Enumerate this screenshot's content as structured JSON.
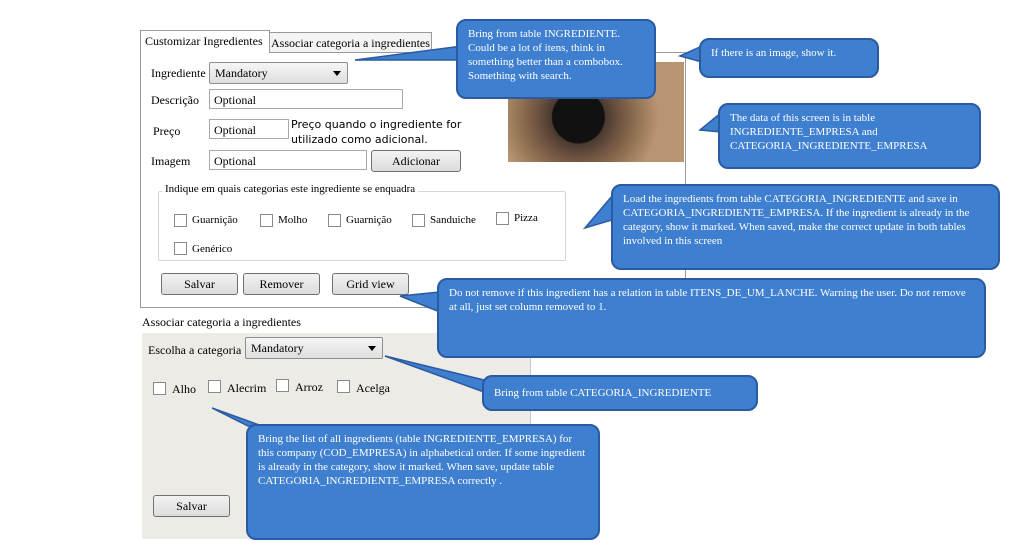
{
  "tabs": [
    {
      "label": "Customizar Ingredientes"
    },
    {
      "label": "Associar categoria a ingredientes"
    }
  ],
  "form": {
    "ingrediente_label": "Ingrediente",
    "ingrediente_value": "Mandatory",
    "descricao_label": "Descrição",
    "descricao_value": "Optional",
    "preco_label": "Preço",
    "preco_value": "Optional",
    "preco_note": "Preço quando o ingrediente for utilizado como adicional.",
    "imagem_label": "Imagem",
    "imagem_value": "Optional",
    "adicionar_label": "Adicionar"
  },
  "categories_group": {
    "title": "Indique em quais categorias este ingrediente se enquadra",
    "items": [
      "Guarnição",
      "Molho",
      "Guarnição",
      "Sanduiche",
      "Pizza",
      "Genérico"
    ]
  },
  "buttons": {
    "salvar": "Salvar",
    "remover": "Remover",
    "grid": "Grid view"
  },
  "assoc": {
    "title": "Associar categoria a ingredientes",
    "choose_label": "Escolha a categoria",
    "choose_value": "Mandatory",
    "items": [
      "Alho",
      "Alecrim",
      "Arroz",
      "Acelga"
    ],
    "salvar": "Salvar"
  },
  "notes": {
    "n1": "Bring from table INGREDIENTE. Could be a lot of itens, think in something better than a combobox. Something with search.",
    "n2": "If there is an image, show it.",
    "n3": "The data of this screen is in table INGREDIENTE_EMPRESA and  CATEGORIA_INGREDIENTE_EMPRESA",
    "n4": "Load the ingredients from table CATEGORIA_INGREDIENTE and save in CATEGORIA_INGREDIENTE_EMPRESA. If the ingredient is already in the category, show it marked. When saved, make the correct update in both tables involved in this screen",
    "n5": "Do not remove if this ingredient has a relation in table ITENS_DE_UM_LANCHE. Warning the user. Do not remove at all, just set column removed to 1.",
    "n6": "Bring from table CATEGORIA_INGREDIENTE",
    "n7": "Bring the list of all ingredients (table INGREDIENTE_EMPRESA) for this company (COD_EMPRESA) in alphabetical order. If some ingredient is already in the category, show it marked. When save, update table CATEGORIA_INGREDIENTE_EMPRESA correctly ."
  }
}
